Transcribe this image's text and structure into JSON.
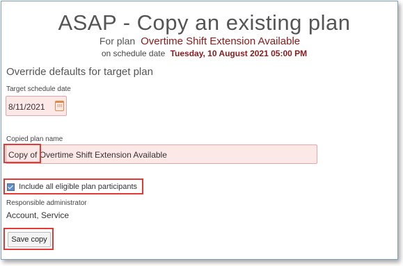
{
  "header": {
    "title": "ASAP - Copy an existing plan",
    "for_plan_prefix": "For plan",
    "plan_name": "Overtime Shift Extension Available",
    "schedule_prefix": "on schedule date",
    "schedule_date": "Tuesday, 10 August 2021 05:00 PM"
  },
  "section_title": "Override defaults for target plan",
  "target_date": {
    "label": "Target schedule date",
    "value": "8/11/2021",
    "icon": "calendar-icon"
  },
  "copied_name": {
    "label": "Copied plan name",
    "value": "Copy of Overtime Shift Extension Available"
  },
  "participants": {
    "label": "Include all eligible plan participants",
    "checked": true
  },
  "admin": {
    "label": "Responsible administrator",
    "value": "Account, Service"
  },
  "actions": {
    "save_label": "Save copy"
  },
  "colors": {
    "plan_name": "#8b1a1a",
    "input_bg": "#fde8e8",
    "highlight": "#e53935",
    "calendar_icon": "#e08a4a"
  }
}
